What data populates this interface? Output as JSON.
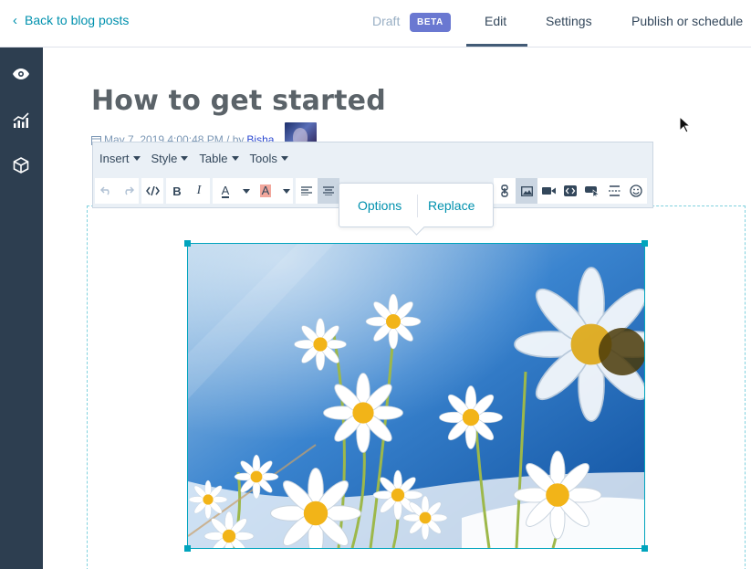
{
  "header": {
    "back_label": "Back to blog posts",
    "status": "Draft",
    "badge": "BETA",
    "tabs": [
      {
        "label": "Edit",
        "active": true
      },
      {
        "label": "Settings",
        "active": false
      },
      {
        "label": "Publish or schedule",
        "active": false
      }
    ]
  },
  "sidebar": {
    "items": [
      {
        "icon": "eye-icon"
      },
      {
        "icon": "analytics-icon"
      },
      {
        "icon": "box-icon"
      }
    ]
  },
  "post": {
    "title": "How to get started",
    "date": "May 7, 2019 4:00:48 PM / by",
    "author": "Bisha"
  },
  "toolbar": {
    "menus": [
      "Insert",
      "Style",
      "Table",
      "Tools"
    ],
    "bold": "B",
    "italic": "I",
    "text_color": "A",
    "highlight": "A"
  },
  "popover": {
    "options_label": "Options",
    "replace_label": "Replace"
  },
  "colors": {
    "link": "#0091ae",
    "sidebar": "#2d3e50",
    "badge": "#6a78d1",
    "selection": "#00a4bd"
  }
}
